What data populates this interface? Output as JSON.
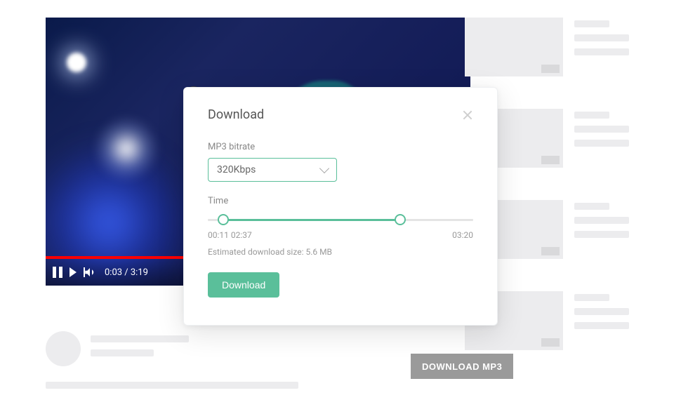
{
  "player": {
    "time_display": "0:03 / 3:19",
    "progress_percent": 38
  },
  "download_button": "DOWNLOAD MP3",
  "modal": {
    "title": "Download",
    "bitrate_label": "MP3 bitrate",
    "bitrate_value": "320Kbps",
    "time_label": "Time",
    "range_start": "00:11",
    "range_end": "02:37",
    "total_time": "03:20",
    "estimated_size": "Estimated download size: 5.6 MB",
    "download_label": "Download"
  },
  "colors": {
    "accent": "#5abf9a"
  }
}
